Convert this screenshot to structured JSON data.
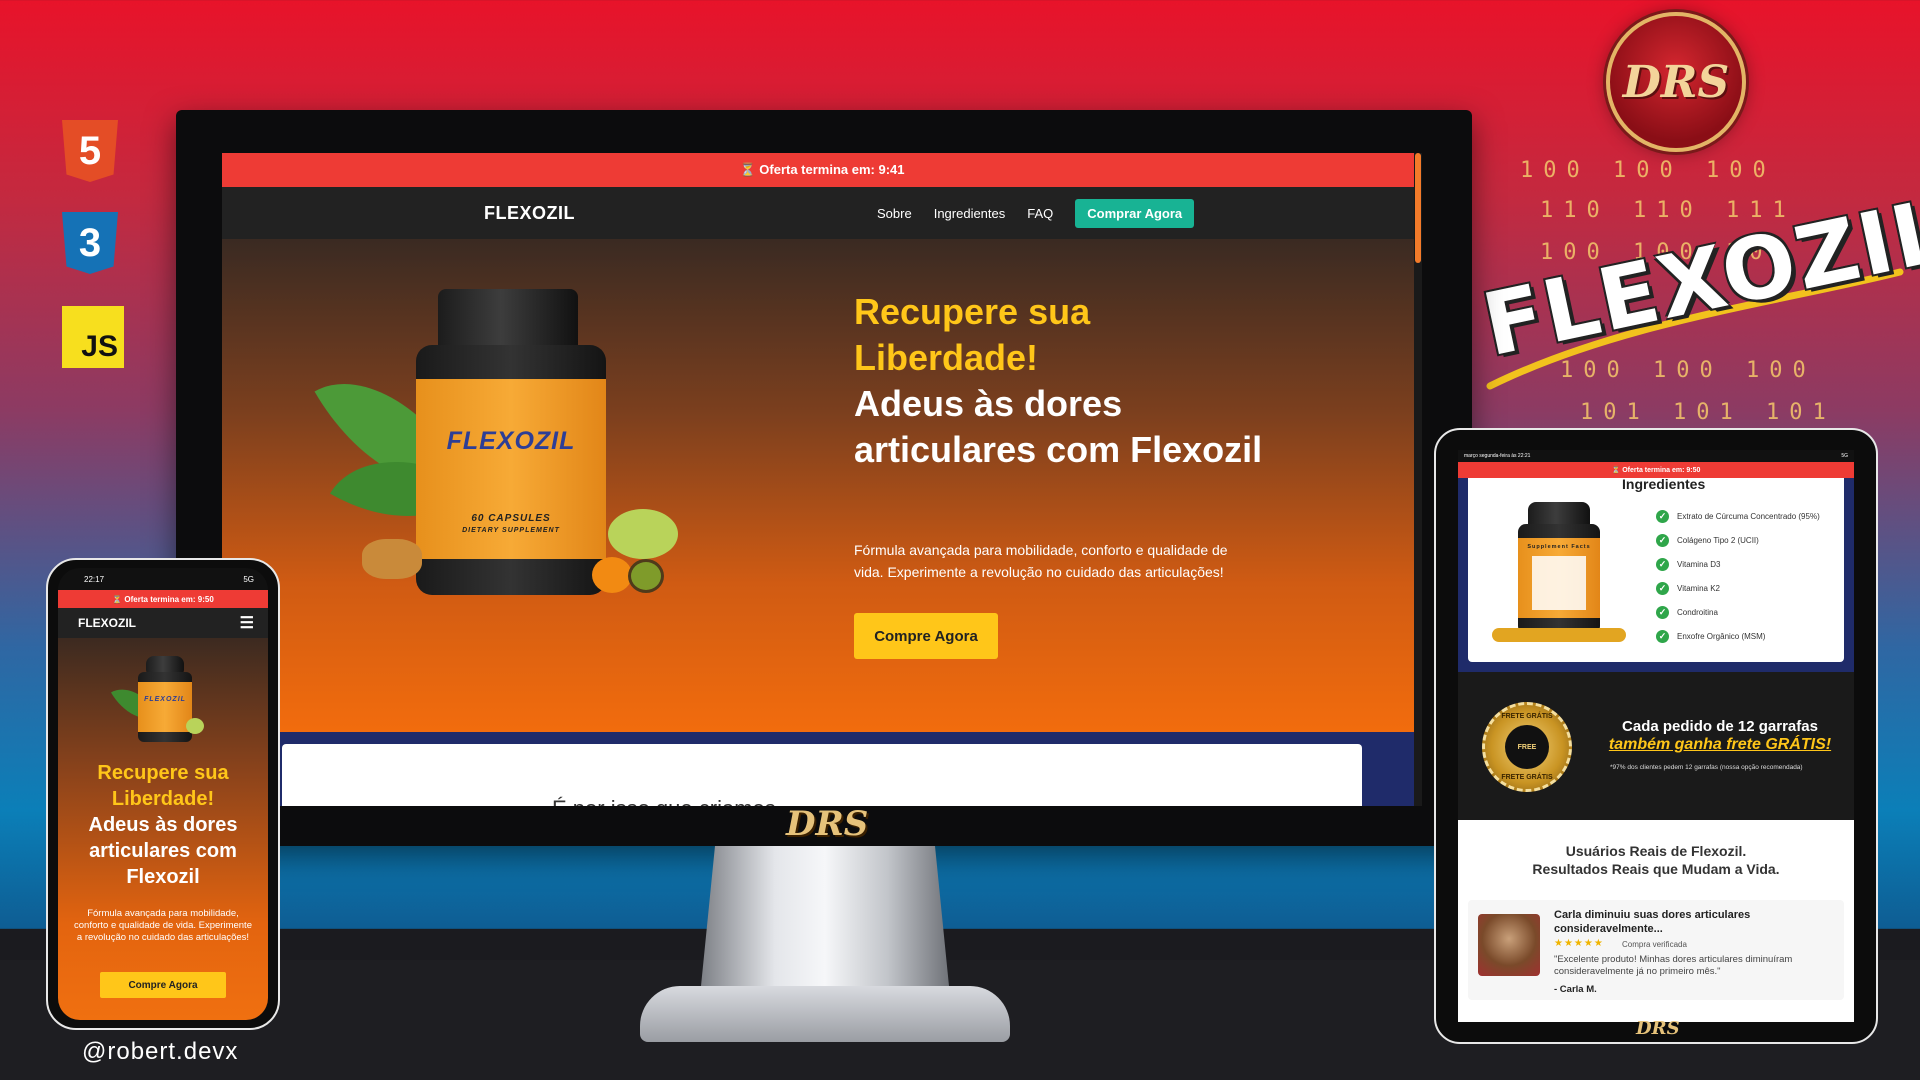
{
  "tech_logos": {
    "html5": "5",
    "css3": "3",
    "js": "JS"
  },
  "brand": {
    "logo_text": "DRS",
    "title": "FLEXOZIL",
    "binary_rows": [
      "100  100  100",
      "110  110  111",
      "100  100  100",
      "100  100  100",
      "101  101  101"
    ],
    "handle": "@robert.devx",
    "accent_color": "#ffc619",
    "offer_color": "#ee3b35",
    "cta_color": "#18b394"
  },
  "desktop": {
    "offer_bar": "⏳ Oferta termina em: 9:41",
    "nav": {
      "logo": "FLEXOZIL",
      "links": [
        "Sobre",
        "Ingredientes",
        "FAQ"
      ],
      "cta": "Comprar Agora"
    },
    "hero": {
      "headline_yellow": "Recupere sua Liberdade!",
      "headline_white": "Adeus às dores articulares com Flexozil",
      "subtitle": "Fórmula avançada para mobilidade, conforto e qualidade de vida. Experimente a revolução no cuidado das articulações!",
      "button": "Compre Agora",
      "jar_brand": "FLEXOZIL",
      "jar_capsules": "60 CAPSULES",
      "jar_note": "DIETARY SUPPLEMENT"
    },
    "next_section_text": "É por isso que criamos",
    "chin_logo": "DRS"
  },
  "phone": {
    "status_time": "22:17",
    "status_right": "5G",
    "offer_bar": "⏳ Oferta termina em: 9:50",
    "nav_logo": "FLEXOZIL",
    "menu_icon": "☰",
    "headline_yellow": "Recupere sua Liberdade!",
    "headline_white": "Adeus às dores articulares com Flexozil",
    "subtitle": "Fórmula avançada para mobilidade, conforto e qualidade de vida. Experimente a revolução no cuidado das articulações!",
    "button": "Compre Agora"
  },
  "tablet": {
    "status_left": "março segunda-feira às 22:21",
    "status_right": "5G",
    "offer_bar": "⏳ Oferta termina em: 9:50",
    "ingredients_title": "Ingredientes",
    "ingredients": [
      "Extrato de Cúrcuma Concentrado (95%)",
      "Colágeno Tipo 2 (UCII)",
      "Vitamina D3",
      "Vitamina K2",
      "Condroitina",
      "Enxofre Orgânico (MSM)"
    ],
    "jar_label": "Supplement Facts",
    "seal_top": "FRETE GRÁTIS",
    "seal_center": "FREE",
    "seal_bottom": "FRETE GRÁTIS",
    "shipping_title": "Cada pedido de 12 garrafas",
    "shipping_highlight": "também ganha frete GRÁTIS!",
    "shipping_note": "*97% dos clientes pedem 12 garrafas (nossa opção recomendada)",
    "reviews_title_1": "Usuários Reais de Flexozil.",
    "reviews_title_2": "Resultados Reais que Mudam a Vida.",
    "review": {
      "title": "Carla diminuiu suas dores articulares consideravelmente...",
      "stars": "★★★★★",
      "verified": "Compra verificada",
      "quote": "\"Excelente produto! Minhas dores articulares diminuíram consideravelmente já no primeiro mês.\"",
      "author": "- Carla M."
    },
    "footer_logo": "DRS"
  }
}
